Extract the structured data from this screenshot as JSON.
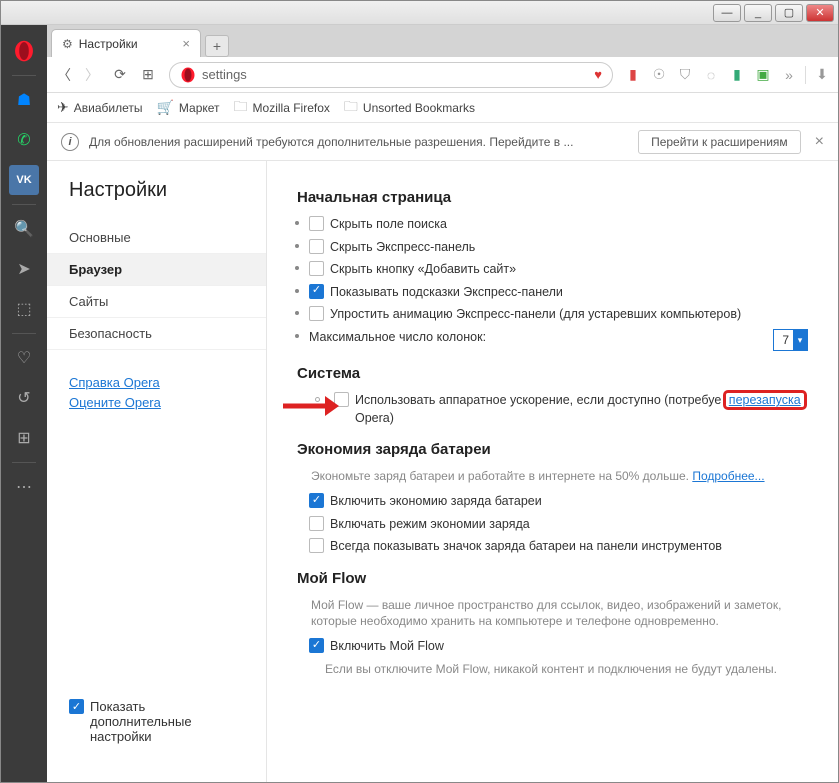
{
  "tab": {
    "title": "Настройки"
  },
  "addr": {
    "text": "settings"
  },
  "bookmarks": {
    "b1": "Авиабилеты",
    "b2": "Маркет",
    "b3": "Mozilla Firefox",
    "b4": "Unsorted Bookmarks"
  },
  "infobar": {
    "text": "Для обновления расширений требуются дополнительные разрешения. Перейдите в ...",
    "button": "Перейти к расширениям"
  },
  "sidebar": {
    "title": "Настройки",
    "items": [
      "Основные",
      "Браузер",
      "Сайты",
      "Безопасность"
    ],
    "links": [
      "Справка Opera",
      "Оцените Opera"
    ],
    "footer": "Показать дополнительные настройки"
  },
  "sections": {
    "startpage": {
      "title": "Начальная страница",
      "opts": [
        "Скрыть поле поиска",
        "Скрыть Экспресс-панель",
        "Скрыть кнопку «Добавить сайт»",
        "Показывать подсказки Экспресс-панели",
        "Упростить анимацию Экспресс-панели (для устаревших компьютеров)"
      ],
      "maxcols_label": "Максимальное число колонок:",
      "maxcols_val": "7"
    },
    "system": {
      "title": "Система",
      "hwaccel_a": "Использовать аппаратное ускорение, если доступно (потребуе",
      "hwaccel_link": "перезапуска",
      "hwaccel_b": "Opera)"
    },
    "battery": {
      "title": "Экономия заряда батареи",
      "desc": "Экономьте заряд батареи и работайте в интернете на 50% дольше. ",
      "more": "Подробнее...",
      "opts": [
        "Включить экономию заряда батареи",
        "Включать режим экономии заряда",
        "Всегда показывать значок заряда батареи на панели инструментов"
      ]
    },
    "flow": {
      "title": "Мой Flow",
      "desc": "Мой Flow — ваше личное пространство для ссылок, видео, изображений и заметок, которые необходимо хранить на компьютере и телефоне одновременно.",
      "opt": "Включить Мой Flow",
      "note": "Если вы отключите Мой Flow, никакой контент и подключения не будут удалены."
    }
  }
}
